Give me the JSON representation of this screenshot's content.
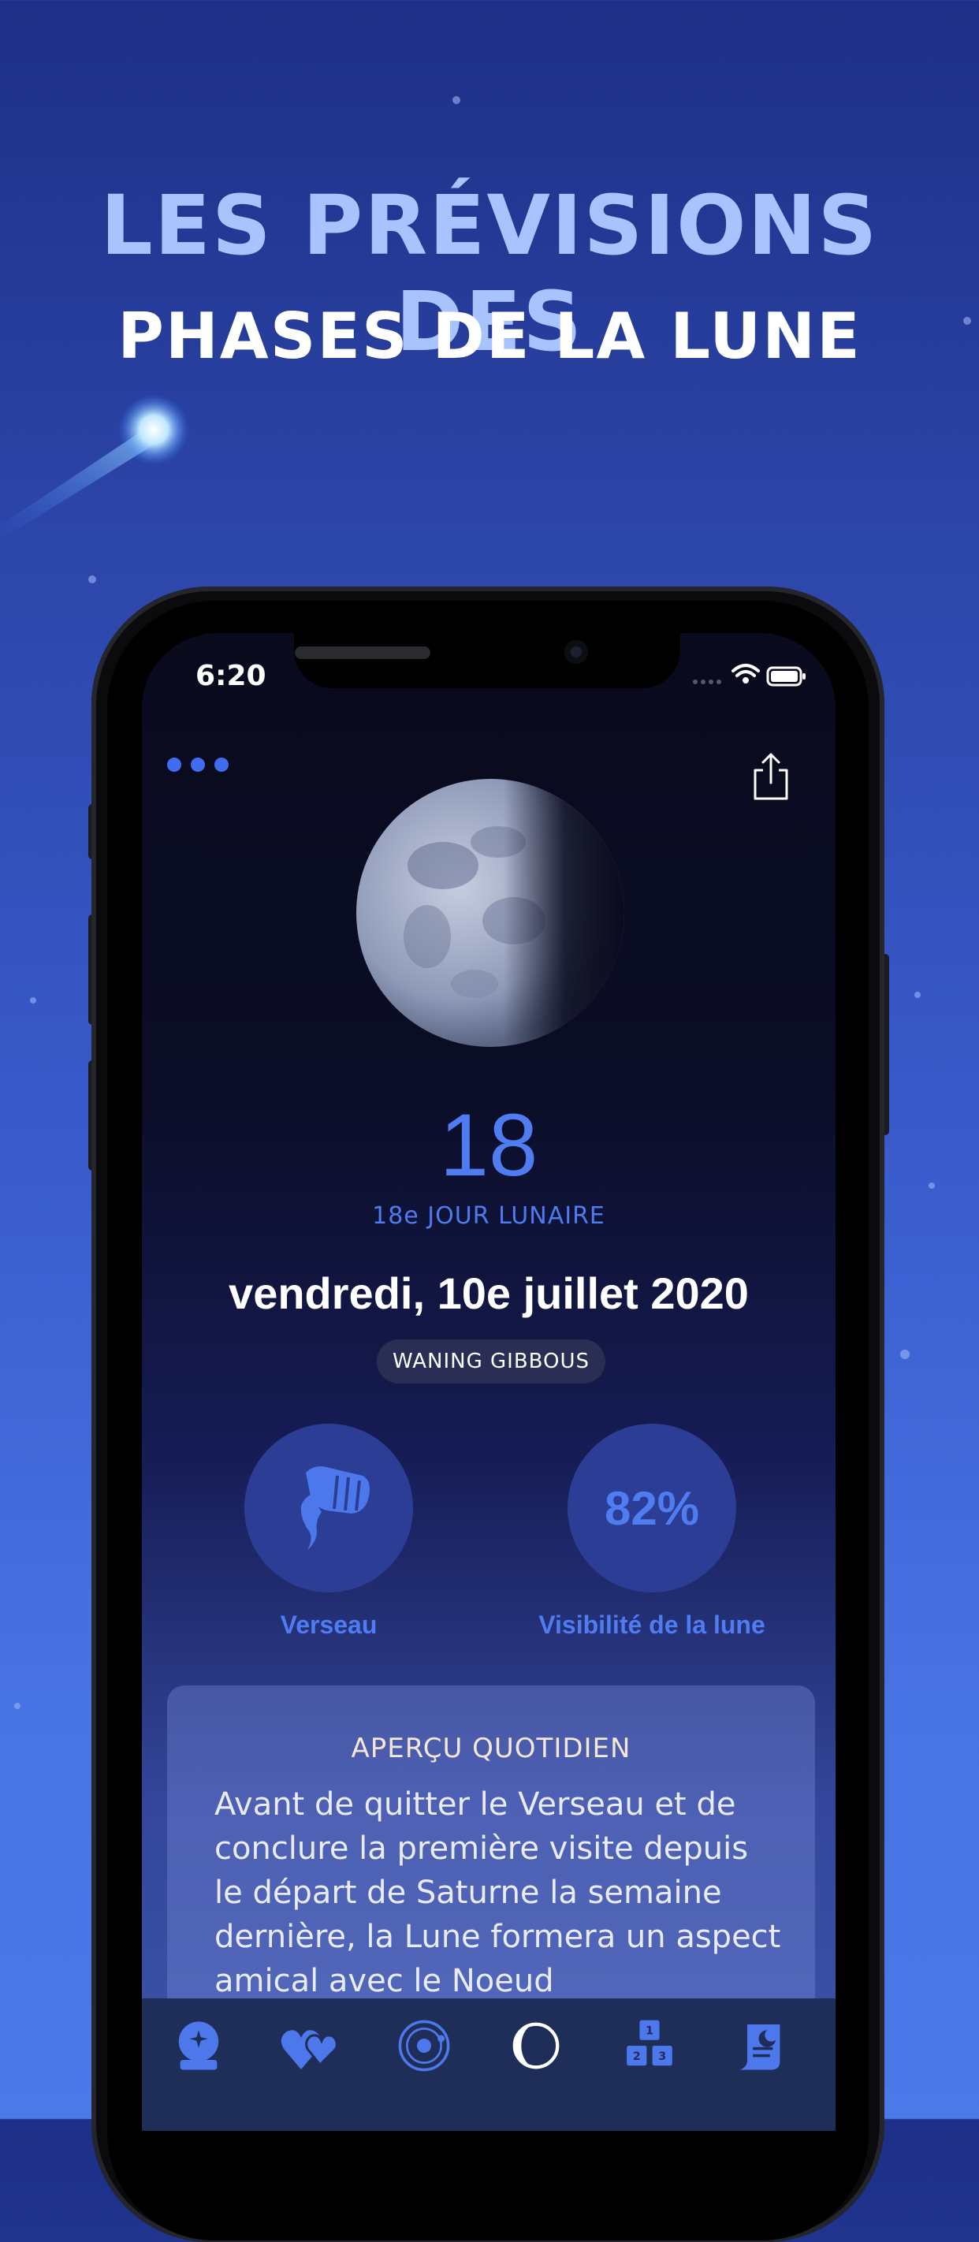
{
  "headline": {
    "line1": "LES PRÉVISIONS DES",
    "line2": "PHASES DE LA LUNE"
  },
  "status_bar": {
    "time": "6:20"
  },
  "moon": {
    "lunar_day_number": "18",
    "lunar_day_label": "18e JOUR LUNAIRE",
    "date": "vendredi, 10e juillet 2020",
    "phase": "WANING GIBBOUS"
  },
  "stats": {
    "zodiac_label": "Verseau",
    "visibility_value": "82%",
    "visibility_label": "Visibilité de la lune"
  },
  "overview": {
    "title": "APERÇU QUOTIDIEN",
    "text": "Avant de quitter le Verseau et de conclure la première visite depuis le départ de Saturne la semaine dernière, la Lune formera un aspect amical avec le Noeud"
  },
  "tabs": [
    {
      "icon": "crystal-ball-icon",
      "active": false
    },
    {
      "icon": "hearts-icon",
      "active": false
    },
    {
      "icon": "solar-system-icon",
      "active": false
    },
    {
      "icon": "moon-phase-icon",
      "active": true
    },
    {
      "icon": "numerology-blocks-icon",
      "active": false
    },
    {
      "icon": "moon-scroll-icon",
      "active": false
    }
  ],
  "colors": {
    "accent": "#4f7cf0",
    "headline_light": "#a9c3ff",
    "tab_icon": "#4c78ec",
    "tab_active": "#ffffff"
  }
}
